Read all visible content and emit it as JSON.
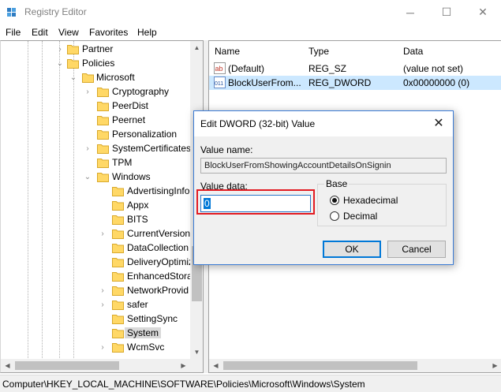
{
  "window": {
    "title": "Registry Editor",
    "minimize": "─",
    "maximize": "☐",
    "close": "✕"
  },
  "menu": [
    "File",
    "Edit",
    "View",
    "Favorites",
    "Help"
  ],
  "tree": {
    "items": [
      {
        "label": "Partner",
        "expander": "›"
      },
      {
        "label": "Policies",
        "expander": "⌄"
      },
      {
        "label": "Microsoft",
        "expander": "⌄"
      },
      {
        "label": "Cryptography",
        "expander": "›"
      },
      {
        "label": "PeerDist",
        "expander": ""
      },
      {
        "label": "Peernet",
        "expander": ""
      },
      {
        "label": "Personalization",
        "expander": ""
      },
      {
        "label": "SystemCertificates",
        "expander": "›"
      },
      {
        "label": "TPM",
        "expander": ""
      },
      {
        "label": "Windows",
        "expander": "⌄"
      },
      {
        "label": "AdvertisingInfo",
        "expander": ""
      },
      {
        "label": "Appx",
        "expander": ""
      },
      {
        "label": "BITS",
        "expander": ""
      },
      {
        "label": "CurrentVersion",
        "expander": "›"
      },
      {
        "label": "DataCollection",
        "expander": ""
      },
      {
        "label": "DeliveryOptimiz",
        "expander": ""
      },
      {
        "label": "EnhancedStora",
        "expander": ""
      },
      {
        "label": "NetworkProvid",
        "expander": "›"
      },
      {
        "label": "safer",
        "expander": "›"
      },
      {
        "label": "SettingSync",
        "expander": ""
      },
      {
        "label": "System",
        "expander": "",
        "selected": true
      },
      {
        "label": "WcmSvc",
        "expander": "›"
      }
    ]
  },
  "list": {
    "columns": [
      "Name",
      "Type",
      "Data"
    ],
    "rows": [
      {
        "icon": "string-value-icon",
        "icon_text": "ab",
        "name": "(Default)",
        "type": "REG_SZ",
        "data": "(value not set)",
        "selected": false
      },
      {
        "icon": "binary-value-icon",
        "icon_text": "011",
        "name": "BlockUserFrom...",
        "type": "REG_DWORD",
        "data": "0x00000000 (0)",
        "selected": true
      }
    ]
  },
  "status": {
    "path": "Computer\\HKEY_LOCAL_MACHINE\\SOFTWARE\\Policies\\Microsoft\\Windows\\System"
  },
  "dialog": {
    "title": "Edit DWORD (32-bit) Value",
    "close": "✕",
    "value_name_label": "Value name:",
    "value_name": "BlockUserFromShowingAccountDetailsOnSignin",
    "value_data_label": "Value data:",
    "value_data": "0",
    "base_label": "Base",
    "base_options": [
      {
        "label": "Hexadecimal",
        "selected": true
      },
      {
        "label": "Decimal",
        "selected": false
      }
    ],
    "ok_label": "OK",
    "cancel_label": "Cancel"
  },
  "colors": {
    "selection": "#cce8ff",
    "highlight_frame": "#e21b22",
    "accent": "#0078d7",
    "folder": "#ffd866"
  }
}
